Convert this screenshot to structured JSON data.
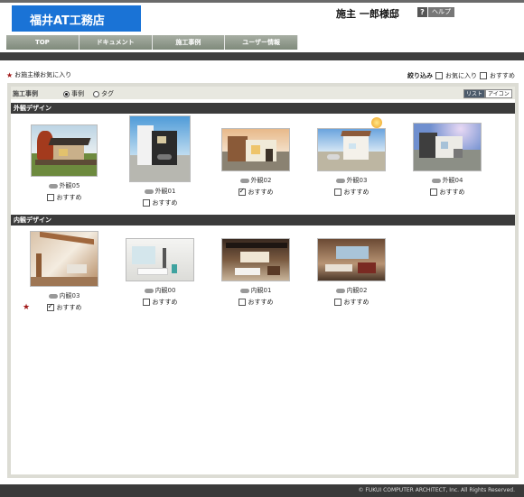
{
  "header": {
    "logo": "福井AT工務店",
    "owner": "施主 一郎様邸",
    "help_q": "?",
    "help_label": "ヘルプ"
  },
  "nav": [
    {
      "label": "TOP"
    },
    {
      "label": "ドキュメント"
    },
    {
      "label": "施工事例"
    },
    {
      "label": "ユーザー情報"
    }
  ],
  "favorites_label": "お施主様お気に入り",
  "filter": {
    "label": "絞り込み",
    "favorite": "お気に入り",
    "recommended": "おすすめ"
  },
  "panel": {
    "title": "施工事例",
    "radio_case": "事例",
    "radio_tag": "タグ",
    "view_list": "リスト",
    "view_icon": "アイコン"
  },
  "sections": [
    {
      "title": "外観デザイン",
      "items": [
        {
          "name": "外観05",
          "rec_label": "おすすめ",
          "recommended": false,
          "favorite": false
        },
        {
          "name": "外観01",
          "rec_label": "おすすめ",
          "recommended": false,
          "favorite": false
        },
        {
          "name": "外観02",
          "rec_label": "おすすめ",
          "recommended": true,
          "favorite": false
        },
        {
          "name": "外観03",
          "rec_label": "おすすめ",
          "recommended": false,
          "favorite": false
        },
        {
          "name": "外観04",
          "rec_label": "おすすめ",
          "recommended": false,
          "favorite": false
        }
      ]
    },
    {
      "title": "内観デザイン",
      "items": [
        {
          "name": "内観03",
          "rec_label": "おすすめ",
          "recommended": true,
          "favorite": true
        },
        {
          "name": "内観00",
          "rec_label": "おすすめ",
          "recommended": false,
          "favorite": false
        },
        {
          "name": "内観01",
          "rec_label": "おすすめ",
          "recommended": false,
          "favorite": false
        },
        {
          "name": "内観02",
          "rec_label": "おすすめ",
          "recommended": false,
          "favorite": false
        }
      ]
    }
  ],
  "footer": "© FUKUI COMPUTER ARCHITECT, Inc. All Rights Reserved."
}
